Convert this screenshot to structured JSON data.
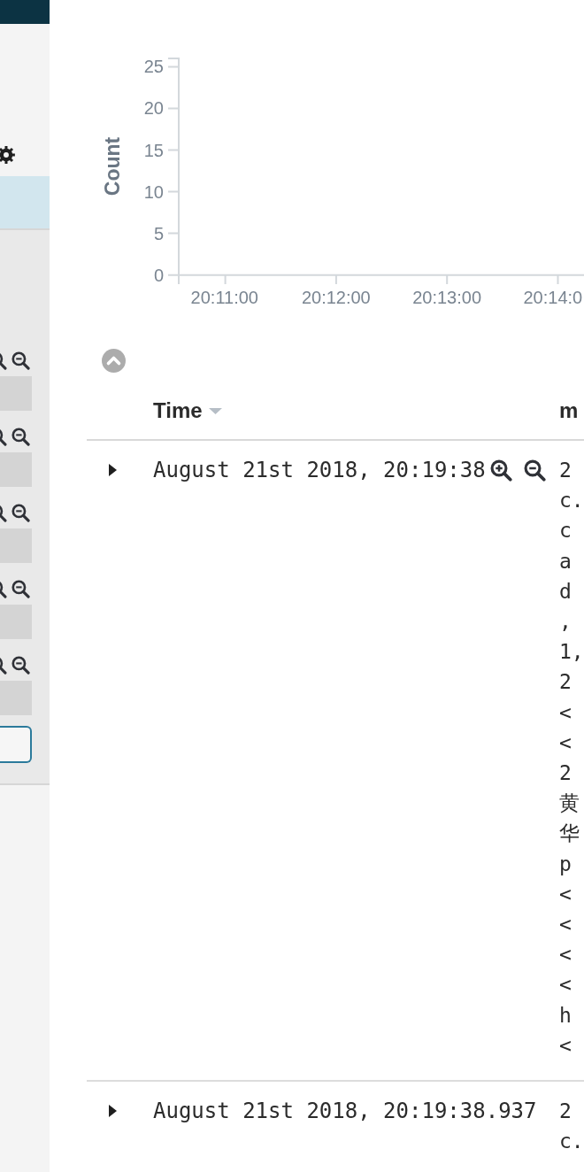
{
  "sidebar": {
    "field_row": {
      "selected": true
    }
  },
  "histogram": {
    "chart_data": {
      "type": "bar",
      "ylabel": "Count",
      "ylim": [
        0,
        26
      ],
      "yticks": [
        0,
        5,
        10,
        15,
        20,
        25
      ],
      "categories": [
        "20:11:00",
        "20:12:00",
        "20:13:00",
        "20:14:0"
      ]
    }
  },
  "table": {
    "columns": [
      {
        "label": "Time",
        "sorted": true
      },
      {
        "label": "m",
        "sorted": false
      }
    ],
    "rows": [
      {
        "expanded": false,
        "hovered": true,
        "time": "August 21st 2018, 20:19:38",
        "message": [
          "2",
          "c.",
          "c",
          "a",
          "d",
          ",",
          "1,",
          "2",
          "<",
          "<",
          "2",
          "黄",
          "华",
          "p",
          "<",
          "<",
          "<",
          "<",
          "h",
          "<"
        ]
      },
      {
        "expanded": false,
        "hovered": false,
        "time": "August 21st 2018, 20:19:38.937",
        "message": [
          "2",
          "c."
        ]
      }
    ]
  }
}
